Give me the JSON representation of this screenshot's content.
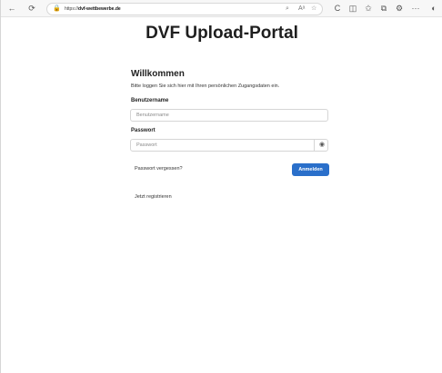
{
  "browser": {
    "url_prefix": "https://",
    "url_host": "dvf-wettbewerbe.de",
    "icons": {
      "back": "←",
      "reload": "⟳",
      "lock": "🔒",
      "search": "⌕",
      "read_aloud": "Aᵃ",
      "favorite": "☆",
      "refresh": "C",
      "split": "◫",
      "favorites": "✩",
      "collections": "⧉",
      "extensions": "⚙",
      "more": "···",
      "copilot": "◐"
    }
  },
  "page": {
    "title": "DVF Upload-Portal",
    "welcome": "Willkommen",
    "subtitle": "Bitte loggen Sie sich hier mit Ihren persönlichen Zugangsdaten ein.",
    "username_label": "Benutzername",
    "username_placeholder": "Benutzername",
    "password_label": "Passwort",
    "password_placeholder": "Passwort",
    "eye_icon": "◉",
    "forgot_password": "Passwort vergessen?",
    "login_button": "Anmelden",
    "register_link": "Jetzt registrieren"
  }
}
